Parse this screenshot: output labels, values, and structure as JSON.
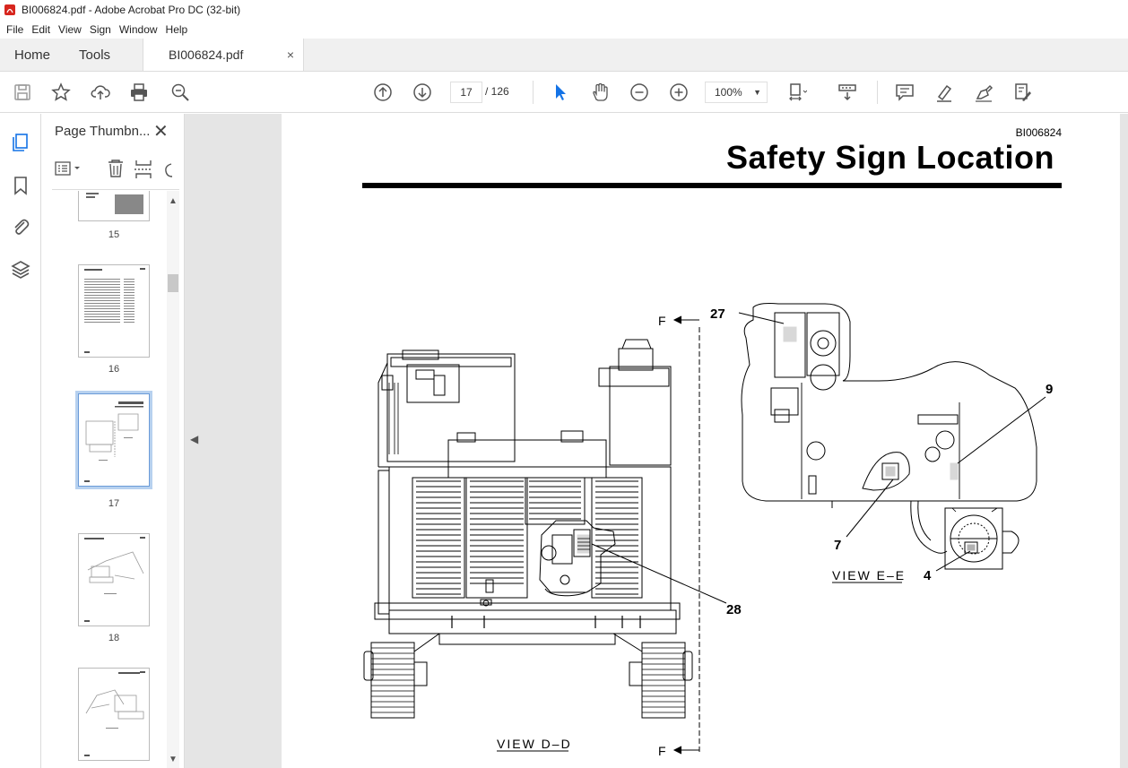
{
  "window": {
    "title": "BI006824.pdf - Adobe Acrobat Pro DC (32-bit)"
  },
  "menu": [
    "File",
    "Edit",
    "View",
    "Sign",
    "Window",
    "Help"
  ],
  "tabs": {
    "home": "Home",
    "tools": "Tools",
    "document": "BI006824.pdf",
    "close": "×"
  },
  "toolbar": {
    "current_page": "17",
    "total_pages": "/ 126",
    "zoom": "100%"
  },
  "thumbnail_panel": {
    "title": "Page Thumbn...",
    "close": "✕",
    "pages": [
      {
        "num": "15"
      },
      {
        "num": "16"
      },
      {
        "num": "17",
        "selected": true
      },
      {
        "num": "18"
      },
      {
        "num": ""
      }
    ]
  },
  "document": {
    "doc_id": "BI006824",
    "title": "Safety Sign Location",
    "callouts": {
      "c27": "27",
      "c9": "9",
      "c7": "7",
      "c4": "4",
      "c28": "28"
    },
    "views": {
      "view_dd": "VIEW  D–D",
      "view_ee": "VIEW  E–E"
    },
    "section_marks": {
      "f_top": "F",
      "f_bottom": "F"
    }
  }
}
